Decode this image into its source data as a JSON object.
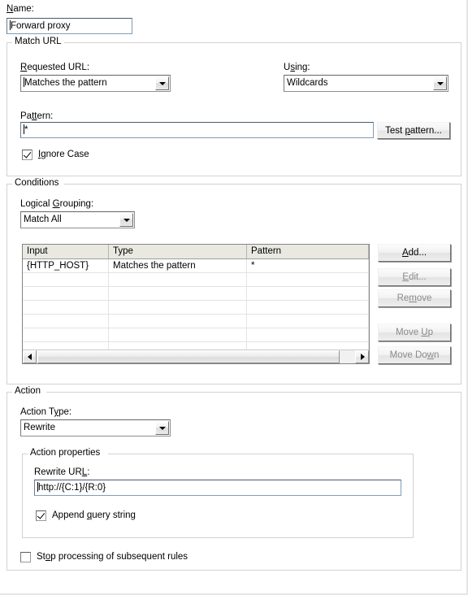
{
  "form": {
    "name_label": "Name:",
    "name_label_accel": "N",
    "name_value": "Forward proxy"
  },
  "match_url": {
    "title": "Match URL",
    "requested_url_label": "Requested URL:",
    "requested_url_accel": "R",
    "requested_url_value": "Matches the pattern",
    "using_label": "Using:",
    "using_accel": "s",
    "using_value": "Wildcards",
    "pattern_label": "Pattern:",
    "pattern_accel": "tt",
    "pattern_value": "*",
    "test_pattern_button": "Test pattern...",
    "test_pattern_accel": "p",
    "ignore_case_label": "Ignore Case",
    "ignore_case_accel": "I",
    "ignore_case_checked": true
  },
  "conditions": {
    "title": "Conditions",
    "logical_grouping_label": "Logical Grouping:",
    "logical_grouping_accel": "G",
    "logical_grouping_value": "Match All",
    "columns": [
      "Input",
      "Type",
      "Pattern"
    ],
    "rows": [
      {
        "input": "{HTTP_HOST}",
        "type": "Matches the pattern",
        "pattern": "*"
      }
    ],
    "empty_row_count": 6,
    "buttons": [
      {
        "label": "Add...",
        "accel": "A",
        "enabled": true
      },
      {
        "label": "Edit...",
        "accel": "E",
        "enabled": false
      },
      {
        "label": "Remove",
        "accel": "m",
        "enabled": false
      },
      {
        "label": "Move Up",
        "accel": "U",
        "enabled": false
      },
      {
        "label": "Move Down",
        "accel": "w",
        "enabled": false
      }
    ],
    "scrollbar": {
      "left_arrow": "left-arrow-icon",
      "right_arrow": "right-arrow-icon"
    }
  },
  "action": {
    "title": "Action",
    "action_type_label": "Action Type:",
    "action_type_accel": "y",
    "action_type_value": "Rewrite",
    "properties_title": "Action properties",
    "rewrite_url_label": "Rewrite URL:",
    "rewrite_url_accel": "L",
    "rewrite_url_value": "http://{C:1}/{R:0}",
    "append_query_label": "Append query string",
    "append_query_accel": "q",
    "append_query_checked": true,
    "stop_processing_label": "Stop processing of subsequent rules",
    "stop_processing_accel": "o",
    "stop_processing_checked": false
  },
  "colors": {
    "background": "#ffffff",
    "group_border": "#d2d2d2",
    "field_border": "#7f9db9",
    "table_header_bg": "#e9e9e2",
    "disabled_text": "#8a8a8a"
  }
}
